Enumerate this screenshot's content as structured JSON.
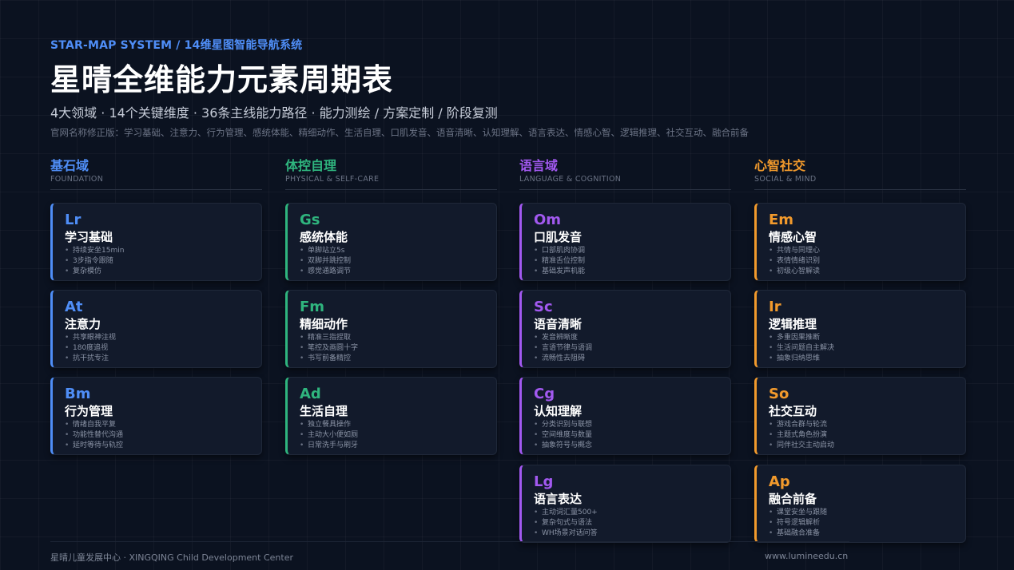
{
  "header": {
    "kicker": "STAR-MAP SYSTEM / 14维星图智能导航系统",
    "title": "星晴全维能力元素周期表",
    "subtitle": "4大领域 · 14个关键维度 · 36条主线能力路径 · 能力测绘 / 方案定制 / 阶段复测",
    "note": "官网名称修正版：学习基础、注意力、行为管理、感统体能、精细动作、生活自理、口肌发音、语音清晰、认知理解、语言表达、情感心智、逻辑推理、社交互动、融合前备"
  },
  "colors": {
    "foundation": "#4f8ef7",
    "physical": "#2fb57e",
    "language": "#a259f0",
    "social": "#f29a2c"
  },
  "domains": [
    {
      "name": "基石域",
      "en": "FOUNDATION",
      "cards": [
        {
          "symbol": "Lr",
          "name": "学习基础",
          "items": [
            "持续安坐15min",
            "3步指令跟随",
            "复杂模仿"
          ]
        },
        {
          "symbol": "At",
          "name": "注意力",
          "items": [
            "共享眼神注视",
            "180度追视",
            "抗干扰专注"
          ]
        },
        {
          "symbol": "Bm",
          "name": "行为管理",
          "items": [
            "情绪自我平复",
            "功能性替代沟通",
            "延时等待与轨控"
          ]
        }
      ]
    },
    {
      "name": "体控自理",
      "en": "PHYSICAL & SELF-CARE",
      "cards": [
        {
          "symbol": "Gs",
          "name": "感统体能",
          "items": [
            "单脚站立5s",
            "双脚并跳控制",
            "感觉通路调节"
          ]
        },
        {
          "symbol": "Fm",
          "name": "精细动作",
          "items": [
            "精准三指捏取",
            "笔控及画圆十字",
            "书写前备精控"
          ]
        },
        {
          "symbol": "Ad",
          "name": "生活自理",
          "items": [
            "独立餐具操作",
            "主动大小便如厕",
            "日常洗手与刷牙"
          ]
        }
      ]
    },
    {
      "name": "语言域",
      "en": "LANGUAGE & COGNITION",
      "cards": [
        {
          "symbol": "Om",
          "name": "口肌发音",
          "items": [
            "口部肌肉协调",
            "精准舌位控制",
            "基础发声机能"
          ]
        },
        {
          "symbol": "Sc",
          "name": "语音清晰",
          "items": [
            "发音辨晰度",
            "言语节律与语调",
            "流畅性去阻碍"
          ]
        },
        {
          "symbol": "Cg",
          "name": "认知理解",
          "items": [
            "分类识别与联想",
            "空间维度与数量",
            "抽象符号与概念"
          ]
        },
        {
          "symbol": "Lg",
          "name": "语言表达",
          "items": [
            "主动词汇量500+",
            "复杂句式与语法",
            "WH场景对话问答"
          ]
        }
      ]
    },
    {
      "name": "心智社交",
      "en": "SOCIAL & MIND",
      "cards": [
        {
          "symbol": "Em",
          "name": "情感心智",
          "items": [
            "共情与同理心",
            "表情情绪识别",
            "初级心智解读"
          ]
        },
        {
          "symbol": "Ir",
          "name": "逻辑推理",
          "items": [
            "多重因果推断",
            "生活问题自主解决",
            "抽象归纳思维"
          ]
        },
        {
          "symbol": "So",
          "name": "社交互动",
          "items": [
            "游戏合群与轮流",
            "主题式角色扮演",
            "同伴社交主动启动"
          ]
        },
        {
          "symbol": "Ap",
          "name": "融合前备",
          "items": [
            "课堂安坐与跟随",
            "符号逻辑解析",
            "基础融合准备"
          ]
        }
      ]
    }
  ],
  "footer": {
    "left": "星晴儿童发展中心 · XINGQING Child Development Center",
    "right": "www.lumineedu.cn"
  }
}
